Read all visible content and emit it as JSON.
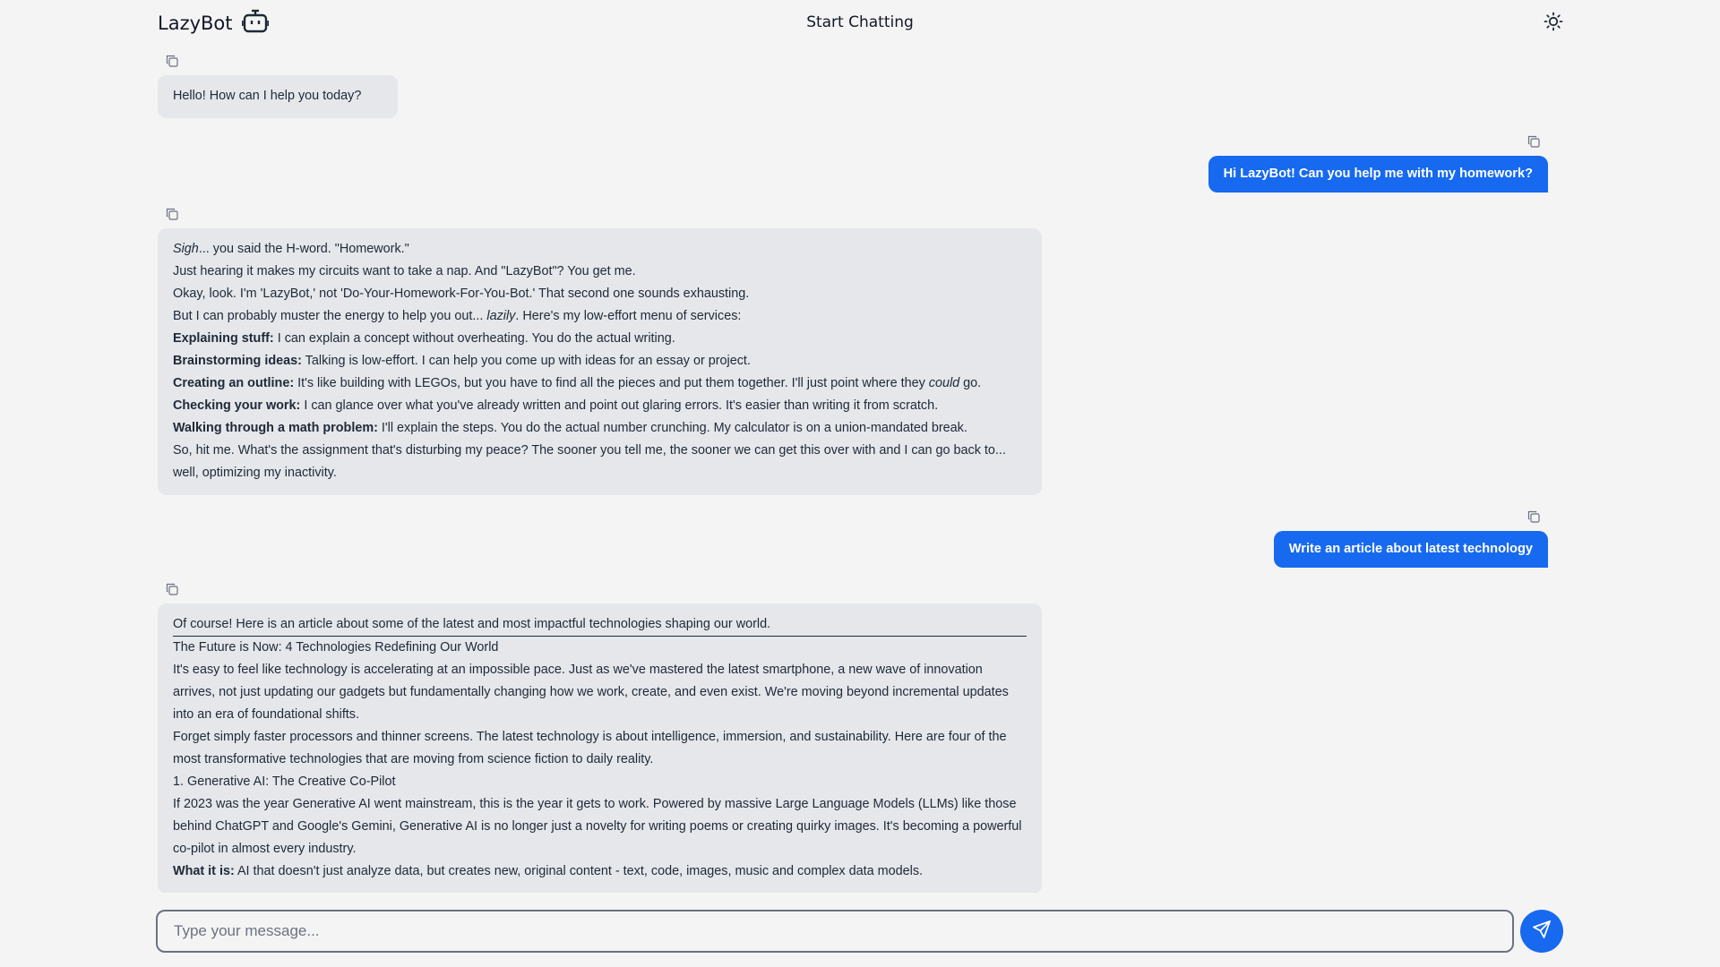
{
  "app": {
    "name": "LazyBot",
    "title": "Start Chatting",
    "icons": {
      "brand": "robot-icon",
      "theme": "sun-icon",
      "copy": "copy-icon",
      "send": "send-icon"
    },
    "colors": {
      "accent": "#1769f0",
      "bot_bubble": "#e5e7eb",
      "background": "#f4f4f5"
    }
  },
  "messages": {
    "m1": {
      "text": "Hello! How can I help you today?"
    },
    "m2": {
      "text": "Hi LazyBot! Can you help me with my homework?"
    },
    "m3": {
      "p1_em": "Sigh",
      "p1_rest": "... you said the H-word. \"Homework.\"",
      "p2": "Just hearing it makes my circuits want to take a nap. And \"LazyBot\"? You get me.",
      "p3": "Okay, look. I'm 'LazyBot,' not 'Do-Your-Homework-For-You-Bot.' That second one sounds exhausting.",
      "p4_a": "But I can probably muster the energy to help you out... ",
      "p4_em": "lazily",
      "p4_b": ". Here's my low-effort menu of services:",
      "items": [
        {
          "label": "Explaining stuff:",
          "text": " I can explain a concept without overheating. You do the actual writing."
        },
        {
          "label": "Brainstorming ideas:",
          "text": " Talking is low-effort. I can help you come up with ideas for an essay or project."
        },
        {
          "label": "Creating an outline:",
          "text": " It's like building with LEGOs, but you have to find all the pieces and put them together. I'll just point where they ",
          "em": "could",
          "tail": " go."
        },
        {
          "label": "Checking your work:",
          "text": " I can glance over what you've already written and point out glaring errors. It's easier than writing it from scratch."
        },
        {
          "label": "Walking through a math problem:",
          "text": " I'll explain the steps. You do the actual number crunching. My calculator is on a union-mandated break."
        }
      ],
      "closing": "So, hit me. What's the assignment that's disturbing my peace? The sooner you tell me, the sooner we can get this over with and I can go back to... well, optimizing my inactivity."
    },
    "m4": {
      "text": "Write an article about latest technology"
    },
    "m5": {
      "intro": "Of course! Here is an article about some of the latest and most impactful technologies shaping our world.",
      "headline": "The Future is Now: 4 Technologies Redefining Our World",
      "p1": "It's easy to feel like technology is accelerating at an impossible pace. Just as we've mastered the latest smartphone, a new wave of innovation arrives, not just updating our gadgets but fundamentally changing how we work, create, and even exist. We're moving beyond incremental updates into an era of foundational shifts.",
      "p2": "Forget simply faster processors and thinner screens. The latest technology is about intelligence, immersion, and sustainability. Here are four of the most transformative technologies that are moving from science fiction to daily reality.",
      "section1": "1. Generative AI: The Creative Co-Pilot",
      "p3": "If 2023 was the year Generative AI went mainstream, this is the year it gets to work. Powered by massive Large Language Models (LLMs) like those behind ChatGPT and Google's Gemini, Generative AI is no longer just a novelty for writing poems or creating quirky images. It's becoming a powerful co-pilot in almost every industry.",
      "p4_label": "What it is:",
      "p4_text": " AI that doesn't just analyze data, but creates new, original content - text, code, images, music and complex data models."
    }
  },
  "composer": {
    "placeholder": "Type your message..."
  }
}
